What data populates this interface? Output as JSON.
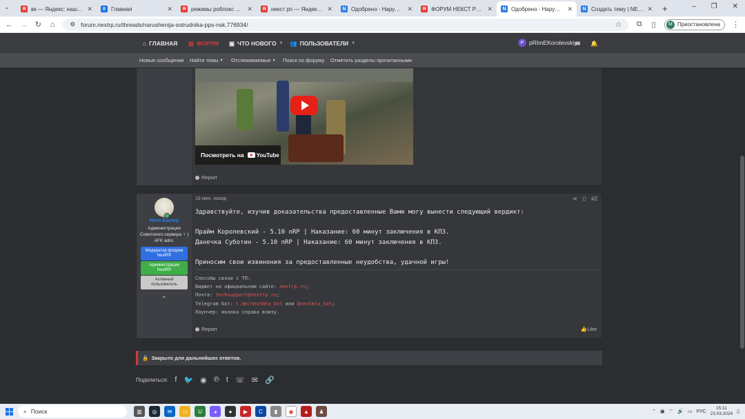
{
  "browser": {
    "tabs": [
      {
        "title": "вк — Яндекс: нашлось 5",
        "color": "#e53935",
        "glyph": "Я"
      },
      {
        "title": "Главная",
        "color": "#1a73e8",
        "glyph": "II"
      },
      {
        "title": "режимы роблокс по тип",
        "color": "#e53935",
        "glyph": "Я"
      },
      {
        "title": "некст рп — Яндекс: наш",
        "color": "#e53935",
        "glyph": "Я"
      },
      {
        "title": "Одобрено - Нарушени",
        "color": "#2f7de1",
        "glyph": "N"
      },
      {
        "title": "ФОРУМ НЕКСТ РП — Ян",
        "color": "#e53935",
        "glyph": "Я"
      },
      {
        "title": "Одобрено - Нарушени",
        "color": "#2f7de1",
        "glyph": "N",
        "active": true
      },
      {
        "title": "Создать тему | NEXTRP",
        "color": "#2f7de1",
        "glyph": "N"
      }
    ],
    "url": "forum.nextrp.ru/threads/narushenija-sotrudnika-pps-nsk.776934/",
    "profile_label": "Приостановлена",
    "profile_initial": "M"
  },
  "forum_nav": {
    "home": "ГЛАВНАЯ",
    "forum": "ФОРУМ",
    "whats_new": "ЧТО НОВОГО",
    "users": "ПОЛЬЗОВАТЕЛИ",
    "username": "pRImEKorolevskiy",
    "user_initial": "P"
  },
  "sub_nav": {
    "new_posts": "Новые сообщения",
    "find_threads": "Найти темы",
    "watched": "Отслеживаемые",
    "search": "Поиск по форуму",
    "mark_read": "Отметить разделы прочитанными"
  },
  "post1": {
    "video_watch": "Посмотреть на",
    "youtube": "YouTube",
    "report": "Report"
  },
  "post2": {
    "time": "18 мин. назад",
    "number": "#2",
    "author": "Натя Вактер",
    "user_title": "Администрация Советского сервера ♀ | AFK adm.",
    "badges": [
      {
        "text": "Модератор форума NextRP",
        "bg": "#2f6fe0",
        "fg": "#ffffff"
      },
      {
        "text": "Администрация NextRP",
        "bg": "#3fae49",
        "fg": "#ffffff"
      },
      {
        "text": "Активный пользователь",
        "bg": "#c9c9c9",
        "fg": "#333333"
      }
    ],
    "body": "Здравствуйте, изучив доказательства предоставленные Вами могу вынести следующий вердикт:\n\nПрайм Королевский - 5.10 nRP | Наказание: 60 минут заключения в КПЗ.\nДанечка Суботин - 5.10 nRP | Наказание: 60 минут заключения в КПЗ.\n\nПриносим свои извинения за предоставленные неудобства, удачной игры!",
    "signature": {
      "l1": "Способы связи с ТП:",
      "l2_pre": "Виджет на официальном сайте: ",
      "l2_link": "nextrp.ru",
      "l2_post": ";",
      "l3_pre": "Почта: ",
      "l3_link": "techsupport@nextrp.ru",
      "l3_post": ";",
      "l4_pre": "Telegram бот: ",
      "l4_link1": "t.me/nextmta_bot",
      "l4_mid": " или ",
      "l4_link2": "@nextmta_bot",
      "l4_post": ";",
      "l5": "Лаунчер: иконка справа внизу."
    },
    "report": "Report",
    "like": "Like"
  },
  "closed_notice": "Закрыто для дальнейших ответов.",
  "share_label": "Поделиться:",
  "taskbar": {
    "search": "Поиск",
    "lang": "РУС",
    "time": "15:11",
    "date": "23.03.2024"
  }
}
